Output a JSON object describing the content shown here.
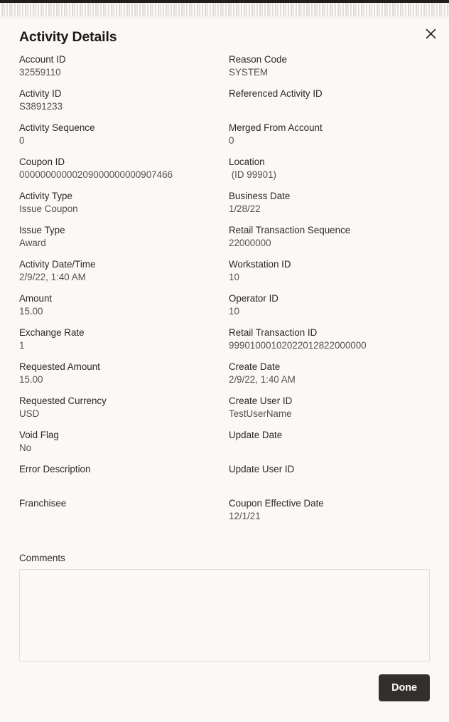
{
  "window": {
    "top_strip_color": "#201d1c",
    "background_color": "#faf9f7"
  },
  "dialog": {
    "title": "Activity Details",
    "close_icon": "close-icon",
    "accent_button_color": "#332f2d"
  },
  "fields": {
    "left": [
      {
        "label": "Account ID",
        "value": "32559110"
      },
      {
        "label": "Activity ID",
        "value": "S3891233"
      },
      {
        "label": "Activity Sequence",
        "value": "0"
      },
      {
        "label": "Coupon ID",
        "value": "00000000000209000000000907466"
      },
      {
        "label": "Activity Type",
        "value": "Issue Coupon"
      },
      {
        "label": "Issue Type",
        "value": "Award"
      },
      {
        "label": "Activity Date/Time",
        "value": "2/9/22, 1:40 AM"
      },
      {
        "label": "Amount",
        "value": "15.00"
      },
      {
        "label": "Exchange Rate",
        "value": "1"
      },
      {
        "label": "Requested Amount",
        "value": "15.00"
      },
      {
        "label": "Requested Currency",
        "value": "USD"
      },
      {
        "label": "Void Flag",
        "value": "No"
      },
      {
        "label": "Error Description",
        "value": ""
      },
      {
        "label": "Franchisee",
        "value": ""
      }
    ],
    "right": [
      {
        "label": "Reason Code",
        "value": "SYSTEM"
      },
      {
        "label": "Referenced Activity ID",
        "value": ""
      },
      {
        "label": "Merged From Account",
        "value": "0"
      },
      {
        "label": "Location",
        "value": " (ID 99901)"
      },
      {
        "label": "Business Date",
        "value": "1/28/22"
      },
      {
        "label": "Retail Transaction Sequence",
        "value": "22000000"
      },
      {
        "label": "Workstation ID",
        "value": "10"
      },
      {
        "label": "Operator ID",
        "value": "10"
      },
      {
        "label": "Retail Transaction ID",
        "value": "99901000102022012822000000"
      },
      {
        "label": "Create Date",
        "value": "2/9/22, 1:40 AM"
      },
      {
        "label": "Create User ID",
        "value": "TestUserName"
      },
      {
        "label": "Update Date",
        "value": ""
      },
      {
        "label": "Update User ID",
        "value": ""
      },
      {
        "label": "Coupon Effective Date",
        "value": "12/1/21"
      }
    ]
  },
  "comments": {
    "label": "Comments",
    "value": "",
    "placeholder": ""
  },
  "footer": {
    "done_label": "Done"
  }
}
